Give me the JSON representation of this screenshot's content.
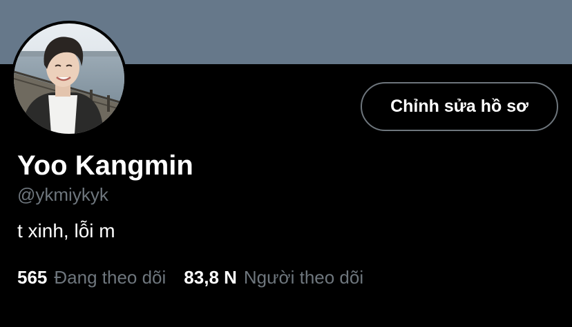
{
  "profile": {
    "display_name": "Yoo Kangmin",
    "handle": "@ykmiykyk",
    "bio": "t xinh, lỗi m",
    "edit_button_label": "Chỉnh sửa hồ sơ"
  },
  "stats": {
    "following": {
      "count": "565",
      "label": "Đang theo dõi"
    },
    "followers": {
      "count": "83,8 N",
      "label": "Người theo dõi"
    }
  },
  "colors": {
    "banner": "#66788a",
    "background": "#000000",
    "primary_text": "#ffffff",
    "secondary_text": "#6e767d",
    "button_border": "#6e767d"
  }
}
